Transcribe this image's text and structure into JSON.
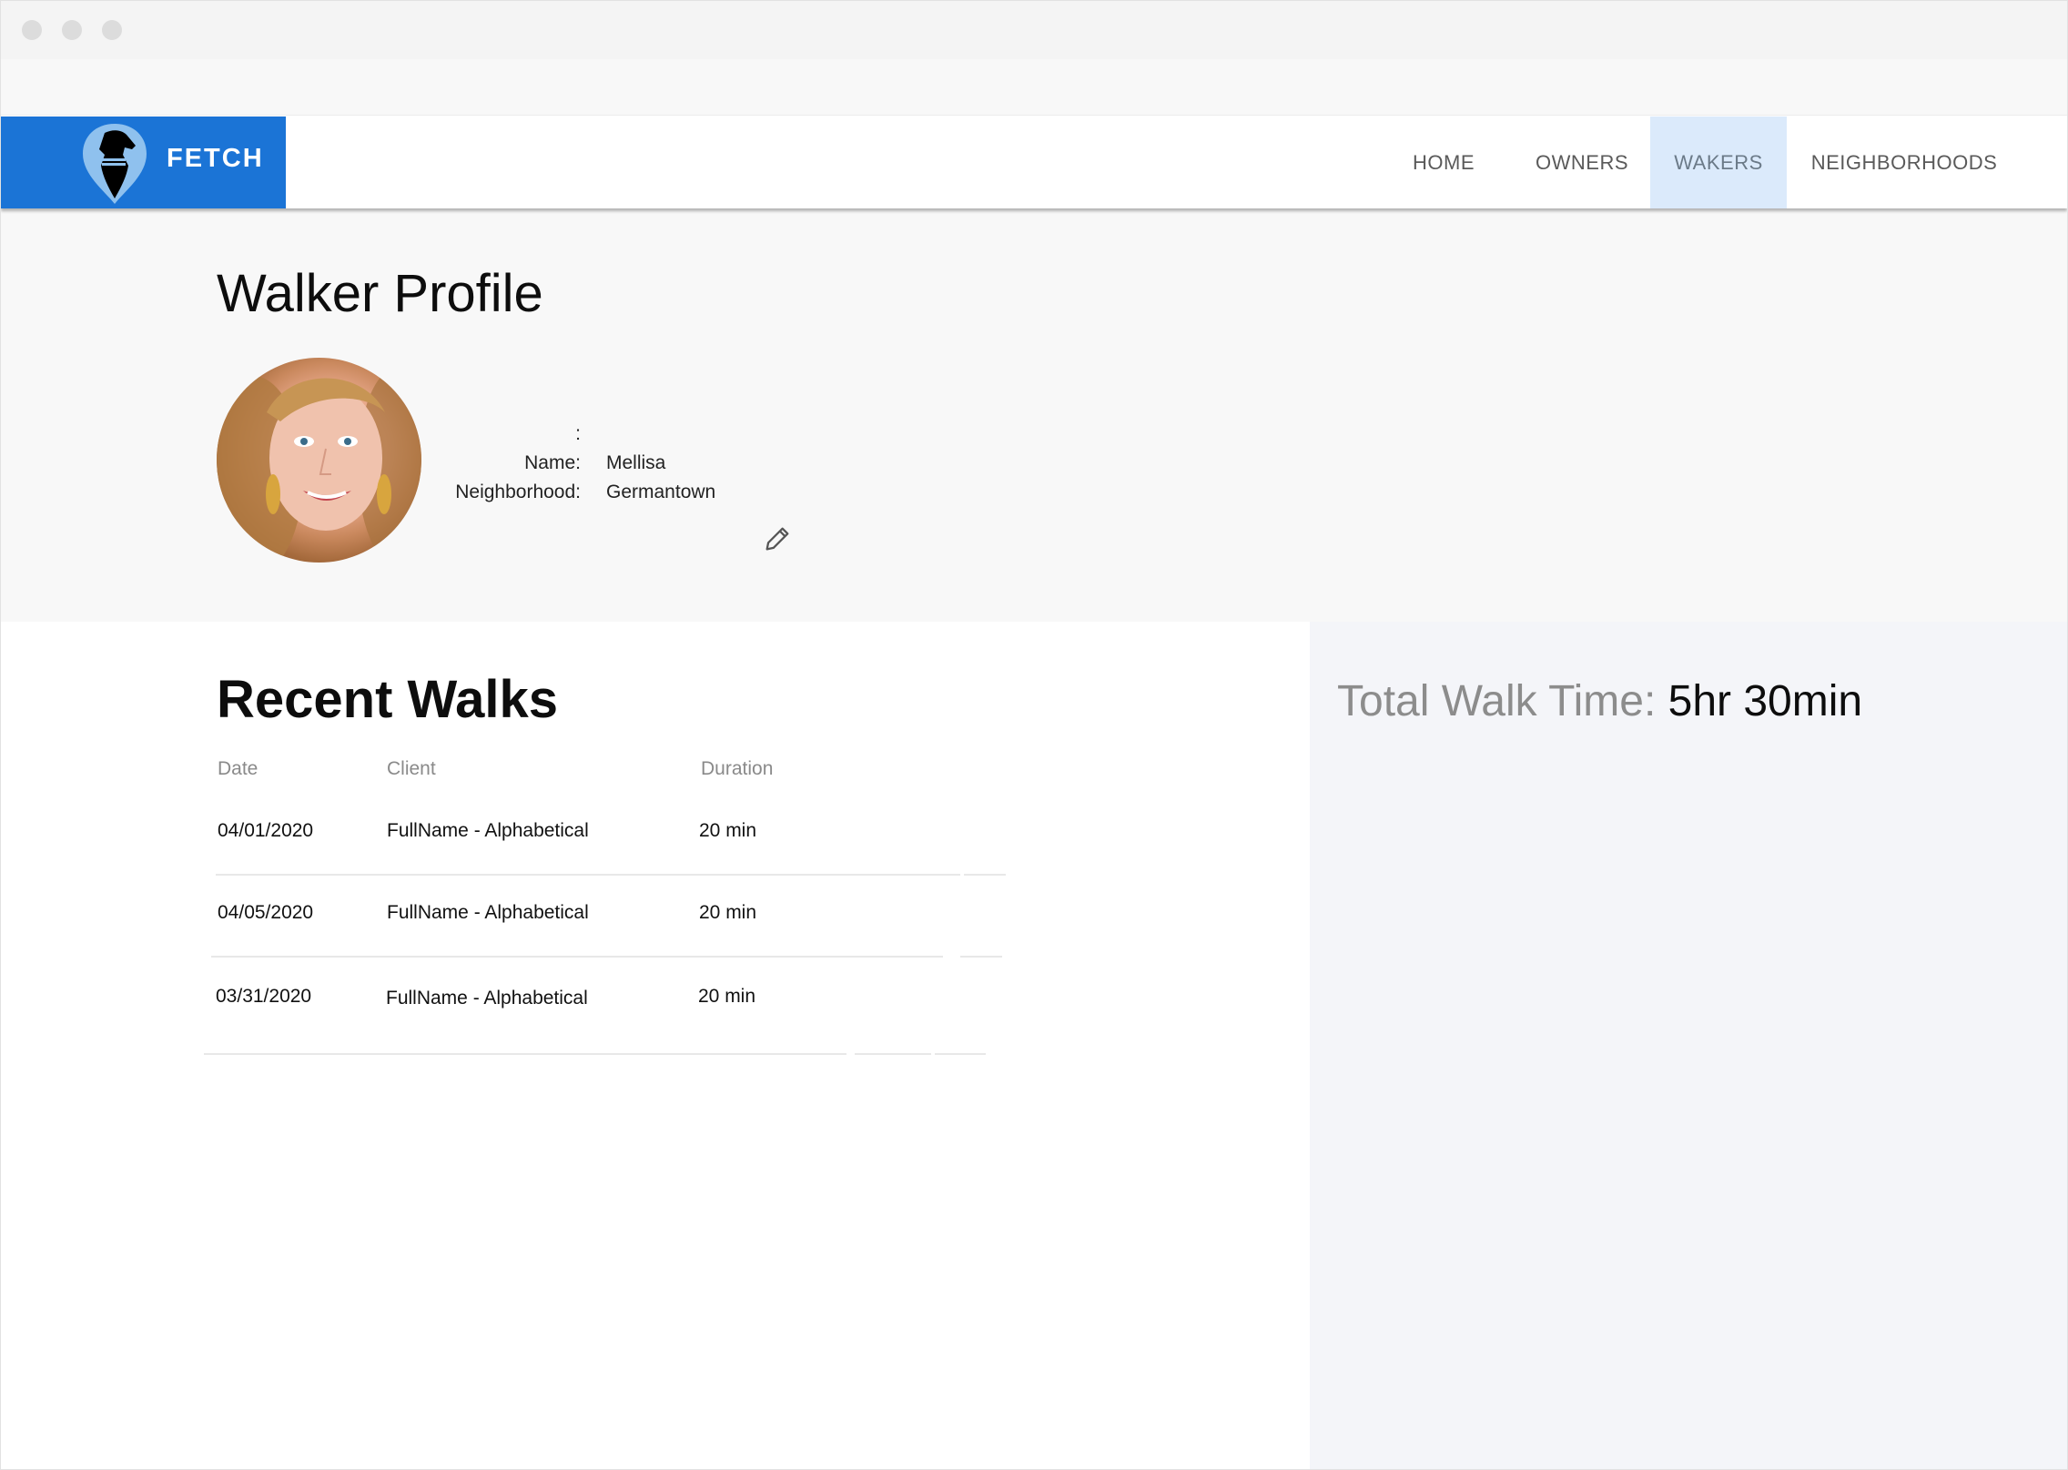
{
  "window": {
    "controls": [
      "close",
      "minimize",
      "maximize"
    ]
  },
  "brand": {
    "name": "FETCH",
    "logo_icon": "dog-pin-icon",
    "color": "#1b74d6"
  },
  "nav": {
    "items": [
      {
        "label": "HOME",
        "active": false
      },
      {
        "label": "OWNERS",
        "active": false
      },
      {
        "label": "WAKERS",
        "active": true
      },
      {
        "label": "NEIGHBORHOODS",
        "active": false
      }
    ],
    "active_color": "#dbeafb"
  },
  "profile": {
    "title": "Walker Profile",
    "colon_row": ":",
    "name_label": "Name:",
    "name_value": "Mellisa",
    "neighborhood_label": "Neighborhood:",
    "neighborhood_value": "Germantown",
    "edit_icon": "pencil-icon"
  },
  "walks": {
    "title": "Recent Walks",
    "columns": [
      "Date",
      "Client",
      "Duration"
    ],
    "rows": [
      {
        "date": "04/01/2020",
        "client": "FullName - Alphabetical",
        "duration": "20 min"
      },
      {
        "date": "04/05/2020",
        "client": "FullName - Alphabetical",
        "duration": "20 min"
      },
      {
        "date": "03/31/2020",
        "client": "FullName - Alphabetical",
        "duration": "20 min"
      }
    ]
  },
  "summary": {
    "total_label": "Total Walk Time:",
    "total_value": "5hr 30min"
  }
}
